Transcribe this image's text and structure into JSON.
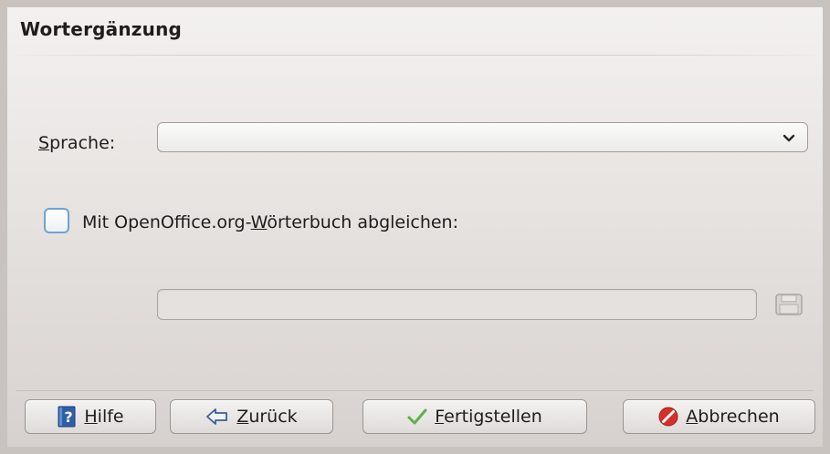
{
  "dialog": {
    "title": "Wortergänzung"
  },
  "language": {
    "label_accel": "S",
    "label_rest": "prache:",
    "selected_value": ""
  },
  "openoffice": {
    "checked": false,
    "label_pre": "Mit OpenOffice.org-",
    "label_accel": "W",
    "label_post": "örterbuch abgleichen:",
    "path_value": ""
  },
  "buttons": {
    "help": {
      "accel": "H",
      "rest": "ilfe",
      "icon": "help-book-icon"
    },
    "back": {
      "accel": "Z",
      "rest": "urück",
      "icon": "left-arrow-icon"
    },
    "finish": {
      "accel": "F",
      "rest": "ertigstellen",
      "icon": "checkmark-icon"
    },
    "cancel": {
      "accel": "A",
      "rest": "bbrechen",
      "icon": "cancel-icon"
    }
  },
  "colors": {
    "checkbox_border": "#6fa3d3",
    "finish_check": "#5fb04a",
    "cancel_red": "#d4312b",
    "help_blue": "#2f5fa8"
  }
}
